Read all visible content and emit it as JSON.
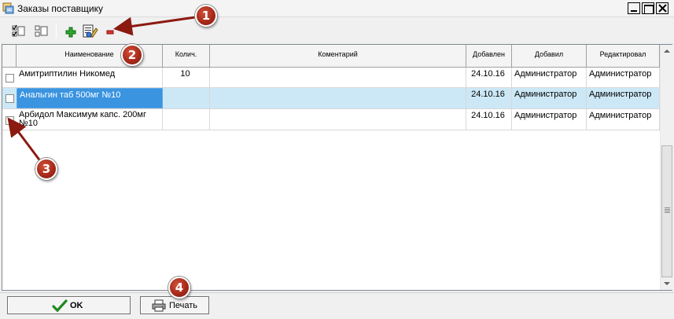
{
  "window": {
    "title": "Заказы поставщику"
  },
  "toolbar": {
    "icons": [
      "check-all-icon",
      "uncheck-all-icon",
      "add-icon",
      "edit-icon",
      "delete-icon"
    ]
  },
  "grid": {
    "columns": [
      "",
      "Наименование",
      "Колич.",
      "Коментарий",
      "Добавлен",
      "Добавил",
      "Редактировал"
    ],
    "rows": [
      {
        "checked": false,
        "name": "Амитриптилин Никомед",
        "qty": "10",
        "comment": "",
        "added": "24.10.16",
        "added_by": "Администратор",
        "edited_by": "Администратор"
      },
      {
        "checked": false,
        "name": "Анальгин таб 500мг №10",
        "qty": "",
        "comment": "",
        "added": "24.10.16",
        "added_by": "Администратор",
        "edited_by": "Администратор"
      },
      {
        "checked": false,
        "name": "Арбидол Максимум капс. 200мг №10",
        "qty": "",
        "comment": "",
        "added": "24.10.16",
        "added_by": "Администратор",
        "edited_by": "Администратор"
      }
    ],
    "selected_row": 1
  },
  "buttons": {
    "ok": "OK",
    "print": "Печать"
  },
  "annotations": [
    "1",
    "2",
    "3",
    "4"
  ],
  "colors": {
    "selection": "#cce8f6",
    "focus_cell": "#3a94e0",
    "marker": "#a72a1b"
  }
}
